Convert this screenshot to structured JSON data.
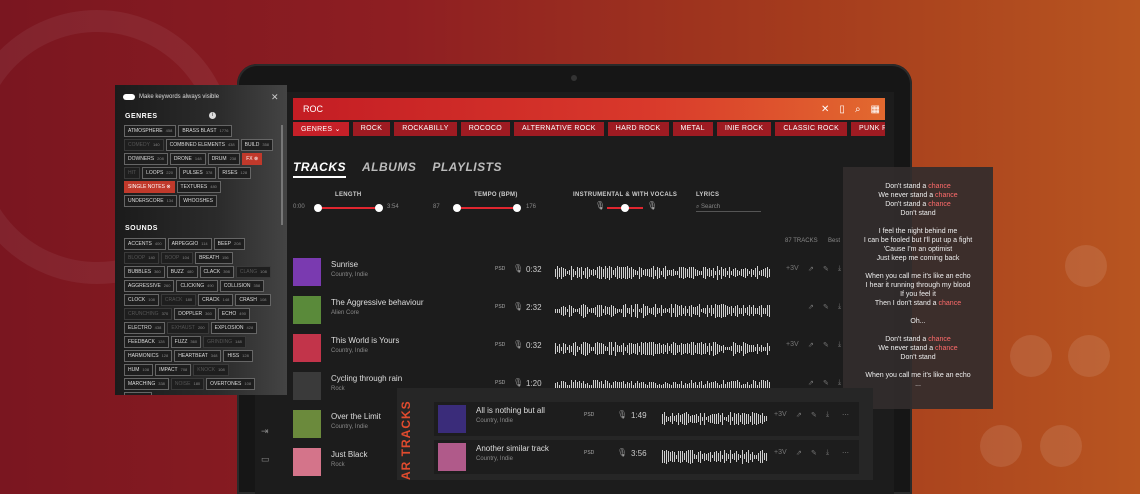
{
  "search": {
    "query": "ROC"
  },
  "genre_chips": [
    "GENRES",
    "ROCK",
    "ROCKABILLY",
    "ROCOCO",
    "ALTERNATIVE ROCK",
    "HARD ROCK",
    "METAL",
    "INIE ROCK",
    "CLASSIC ROCK",
    "PUNK ROC"
  ],
  "tabs": [
    "TRACKS",
    "ALBUMS",
    "PLAYLISTS"
  ],
  "filters": {
    "length": {
      "label": "LENGTH",
      "min": "0:00",
      "max": "3:54"
    },
    "tempo": {
      "label": "TEMPO (BPM)",
      "min": "87",
      "max": "176"
    },
    "instrumental": {
      "label": "INSTRUMENTAL & WITH VOCALS"
    },
    "lyrics": {
      "label": "LYRICS",
      "placeholder": "Search"
    }
  },
  "track_count": "87 TRACKS",
  "tracks": [
    {
      "title": "Sunrise",
      "subtitle": "Country, Indie",
      "format": "PSD",
      "duration": "0:32",
      "extra": "+3V",
      "art_color": "#7a3ab0"
    },
    {
      "title": "The Aggressive behaviour",
      "subtitle": "Alien Core",
      "format": "PSD",
      "duration": "2:32",
      "extra": "",
      "art_color": "#5a8a3a"
    },
    {
      "title": "This World is Yours",
      "subtitle": "Country, Indie",
      "format": "PSD",
      "duration": "0:32",
      "extra": "+3V",
      "art_color": "#c2344a"
    },
    {
      "title": "Cycling through rain",
      "subtitle": "Rock",
      "format": "PSD",
      "duration": "1:20",
      "extra": "",
      "art_color": "#3a3a3a"
    },
    {
      "title": "Over the Limit",
      "subtitle": "Country, Indie",
      "format": "",
      "duration": "",
      "extra": "",
      "art_color": "#6b8a3c"
    },
    {
      "title": "Just Black",
      "subtitle": "Rock",
      "format": "",
      "duration": "",
      "extra": "",
      "art_color": "#d4748a"
    }
  ],
  "keywords_panel": {
    "toggle_label": "Make keywords always visible",
    "genres_title": "GENRES",
    "genres": [
      {
        "label": "ATMOSPHERE",
        "count": "458",
        "state": "normal"
      },
      {
        "label": "BRASS BLAST",
        "count": "1776",
        "state": "normal"
      },
      {
        "label": "COMEDY",
        "count": "140",
        "state": "dim"
      },
      {
        "label": "COMBINED ELEMENTS",
        "count": "438",
        "state": "normal"
      },
      {
        "label": "BUILD",
        "count": "358",
        "state": "normal"
      },
      {
        "label": "DOWNERS",
        "count": "208",
        "state": "normal"
      },
      {
        "label": "DRONE",
        "count": "148",
        "state": "normal"
      },
      {
        "label": "DRUM",
        "count": "238",
        "state": "normal"
      },
      {
        "label": "FX",
        "count": "",
        "state": "sel"
      },
      {
        "label": "HIT",
        "count": "",
        "state": "dim"
      },
      {
        "label": "LOOPS",
        "count": "220",
        "state": "normal"
      },
      {
        "label": "PULSES",
        "count": "378",
        "state": "normal"
      },
      {
        "label": "RISES",
        "count": "128",
        "state": "normal"
      },
      {
        "label": "SINGLE NOTES",
        "count": "",
        "state": "sel"
      },
      {
        "label": "TEXTURES",
        "count": "480",
        "state": "normal"
      },
      {
        "label": "UNDERSCORE",
        "count": "134",
        "state": "normal"
      },
      {
        "label": "WHOOSHES",
        "count": "",
        "state": "normal"
      }
    ],
    "sounds_title": "SOUNDS",
    "sounds": [
      {
        "label": "ACCENTS",
        "count": "400",
        "state": "normal"
      },
      {
        "label": "ARPEGGIO",
        "count": "114",
        "state": "normal"
      },
      {
        "label": "BEEP",
        "count": "208",
        "state": "normal"
      },
      {
        "label": "BLOOP",
        "count": "140",
        "state": "dim"
      },
      {
        "label": "BOOP",
        "count": "104",
        "state": "dim"
      },
      {
        "label": "BREATH",
        "count": "156",
        "state": "normal"
      },
      {
        "label": "BUBBLES",
        "count": "360",
        "state": "normal"
      },
      {
        "label": "BUZZ",
        "count": "480",
        "state": "normal"
      },
      {
        "label": "CLACK",
        "count": "398",
        "state": "normal"
      },
      {
        "label": "CLANG",
        "count": "108",
        "state": "dim"
      },
      {
        "label": "AGGRESSIVE",
        "count": "260",
        "state": "normal"
      },
      {
        "label": "CLICKING",
        "count": "490",
        "state": "normal"
      },
      {
        "label": "COLLISION",
        "count": "358",
        "state": "normal"
      },
      {
        "label": "CLOCK",
        "count": "108",
        "state": "normal"
      },
      {
        "label": "CRACK",
        "count": "180",
        "state": "dim"
      },
      {
        "label": "CRACK",
        "count": "148",
        "state": "normal"
      },
      {
        "label": "CRASH",
        "count": "108",
        "state": "normal"
      },
      {
        "label": "CRUNCHING",
        "count": "370",
        "state": "dim"
      },
      {
        "label": "DOPPLER",
        "count": "360",
        "state": "normal"
      },
      {
        "label": "ECHO",
        "count": "490",
        "state": "normal"
      },
      {
        "label": "ELECTRO",
        "count": "438",
        "state": "normal"
      },
      {
        "label": "EXHAUST",
        "count": "200",
        "state": "dim"
      },
      {
        "label": "EXPLOSION",
        "count": "428",
        "state": "normal"
      },
      {
        "label": "FEEDBACK",
        "count": "128",
        "state": "normal"
      },
      {
        "label": "FUZZ",
        "count": "360",
        "state": "normal"
      },
      {
        "label": "GRINDING",
        "count": "148",
        "state": "dim"
      },
      {
        "label": "HARMONICS",
        "count": "128",
        "state": "normal"
      },
      {
        "label": "HEARTBEAT",
        "count": "348",
        "state": "normal"
      },
      {
        "label": "HISS",
        "count": "128",
        "state": "normal"
      },
      {
        "label": "HUM",
        "count": "108",
        "state": "normal"
      },
      {
        "label": "IMPACT",
        "count": "708",
        "state": "normal"
      },
      {
        "label": "KNOCK",
        "count": "108",
        "state": "dim"
      },
      {
        "label": "MARCHING",
        "count": "338",
        "state": "normal"
      },
      {
        "label": "NOISE",
        "count": "180",
        "state": "dim"
      },
      {
        "label": "OVERTONES",
        "count": "108",
        "state": "normal"
      },
      {
        "label": "PAD",
        "count": "128",
        "state": "normal"
      }
    ]
  },
  "lyrics": [
    [
      {
        "t": "Don't stand a "
      },
      {
        "t": "chance",
        "hl": true
      }
    ],
    [
      {
        "t": "We never stand a "
      },
      {
        "t": "chance",
        "hl": true
      }
    ],
    [
      {
        "t": "Don't stand a "
      },
      {
        "t": "chance",
        "hl": true
      }
    ],
    [
      {
        "t": "Don't stand"
      }
    ],
    [
      {
        "t": ""
      }
    ],
    [
      {
        "t": "I feel the night behind me"
      }
    ],
    [
      {
        "t": "I can be fooled but I'll put up a fight"
      }
    ],
    [
      {
        "t": "'Cause I'm an optimist"
      }
    ],
    [
      {
        "t": "Just keep me coming back"
      }
    ],
    [
      {
        "t": ""
      }
    ],
    [
      {
        "t": "When you call me it's like an echo"
      }
    ],
    [
      {
        "t": "I hear it running through my blood"
      }
    ],
    [
      {
        "t": "If you feel it"
      }
    ],
    [
      {
        "t": "Then I don't stand a "
      },
      {
        "t": "chance",
        "hl": true
      }
    ],
    [
      {
        "t": ""
      }
    ],
    [
      {
        "t": "Oh..."
      }
    ],
    [
      {
        "t": ""
      }
    ],
    [
      {
        "t": "Don't stand a "
      },
      {
        "t": "chance",
        "hl": true
      }
    ],
    [
      {
        "t": "We never stand a "
      },
      {
        "t": "chance",
        "hl": true
      }
    ],
    [
      {
        "t": "Don't stand"
      }
    ],
    [
      {
        "t": ""
      }
    ],
    [
      {
        "t": "When you call me it's like an echo"
      }
    ],
    [
      {
        "t": "..."
      }
    ]
  ],
  "similar": {
    "label": "AR TRACKS",
    "tracks": [
      {
        "title": "All is nothing but all",
        "subtitle": "Country, Indie",
        "format": "PSD",
        "duration": "1:49",
        "extra": "+3V",
        "art_color": "#3a2c7a"
      },
      {
        "title": "Another similar track",
        "subtitle": "Country, Indie",
        "format": "PSD",
        "duration": "3:56",
        "extra": "+3V",
        "art_color": "#b05a8a"
      }
    ]
  },
  "partial_label": "Best",
  "colors": {
    "accent": "#e0262f",
    "highlight": "#ff6b6b"
  }
}
